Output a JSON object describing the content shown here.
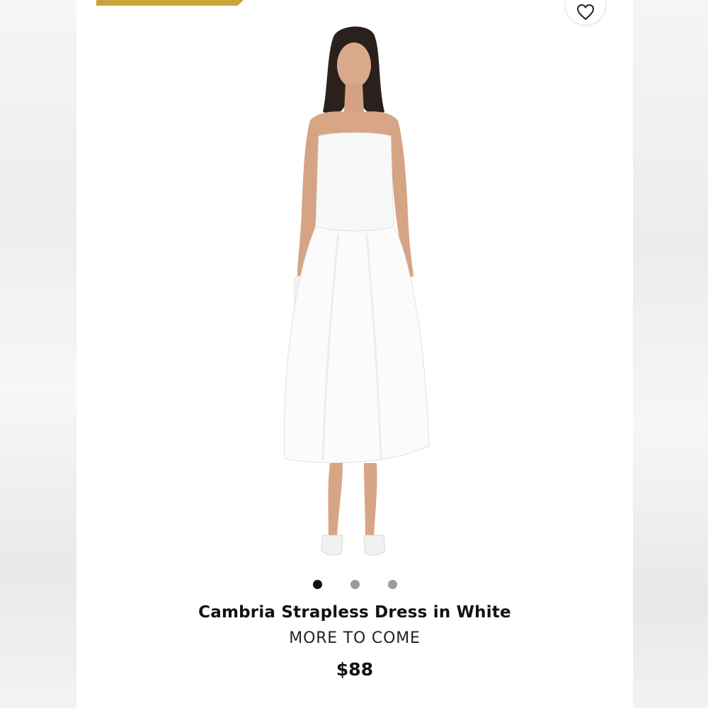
{
  "product": {
    "title": "Cambria Strapless Dress in White",
    "brand": "MORE TO COME",
    "price": "$88",
    "image_alt_icon": "dress-photo",
    "carousel": {
      "total": 3,
      "active_index": 0
    }
  },
  "icons": {
    "wishlist": "heart-outline-icon"
  },
  "colors": {
    "banner": "#c9a43b",
    "dot_active": "#111111",
    "dot_inactive": "#9a9a9a"
  }
}
